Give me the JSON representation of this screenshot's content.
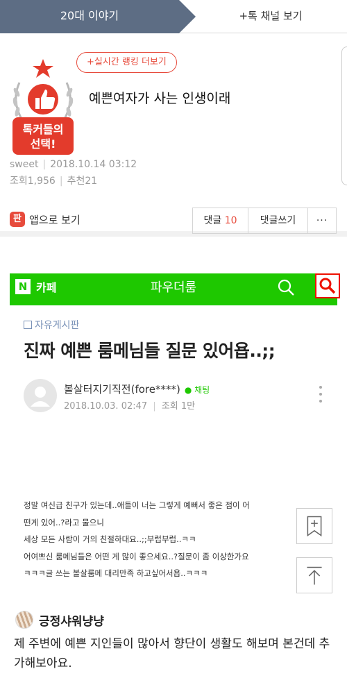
{
  "tabs": {
    "active": "20대 이야기",
    "other": "+톡 채널 보기"
  },
  "badge": {
    "line1": "톡커들의",
    "line2": "선택!"
  },
  "post": {
    "ranking_button": "+실시간 랭킹 더보기",
    "title": "예쁜여자가 사는 인생이래",
    "author": "sweet",
    "datetime": "2018.10.14 03:12",
    "views": "조회1,956",
    "recommends": "추천21"
  },
  "actions": {
    "app_icon": "판",
    "app_view": "앱으로 보기",
    "comment_label": "댓글",
    "comment_count": "10",
    "write_comment": "댓글쓰기",
    "more": "···"
  },
  "embedded": {
    "cafe_logo": "N",
    "cafe_label": "카페",
    "cafe_name": "파우더룸",
    "board": "자유게시판",
    "title": "진짜 예쁜 룸메님들 질문 있어욥..;;",
    "author": "볼살터지기직전(fore****)",
    "chat": "채팅",
    "date": "2018.10.03. 02:47",
    "views": "조회 1만",
    "lines": [
      "정말 여신급 친구가 있는데..애들이 너는 그렇게 예뻐서 좋은 점이 어",
      "떤게 있어..?라고 물으니",
      "세상 모든 사람이 거의 친절하대요..;;부럽부럽..ㅋㅋ",
      "어여쁘신 룸메님들은 어떤 게 많이 좋으세요..?질문이 좀 이상한가요",
      "ㅋㅋㅋ글 쓰는 볼살룸메 대리만족 하고싶어서욥..ㅋㅋㅋ"
    ]
  },
  "comment": {
    "name": "긍정샤워냥냥",
    "text": "제 주변에 예쁜 지인들이 많아서 향단이 생활도 해보며 본건데 추가해보아요."
  },
  "icons": {
    "badge": "thumbs-up-laurel-badge",
    "bookmark": "bookmark-plus-icon",
    "top": "scroll-top-icon",
    "search": "search-icon"
  },
  "colors": {
    "tab": "#5d6d84",
    "accent": "#e74b3c",
    "cafe_green": "#1ec800"
  }
}
